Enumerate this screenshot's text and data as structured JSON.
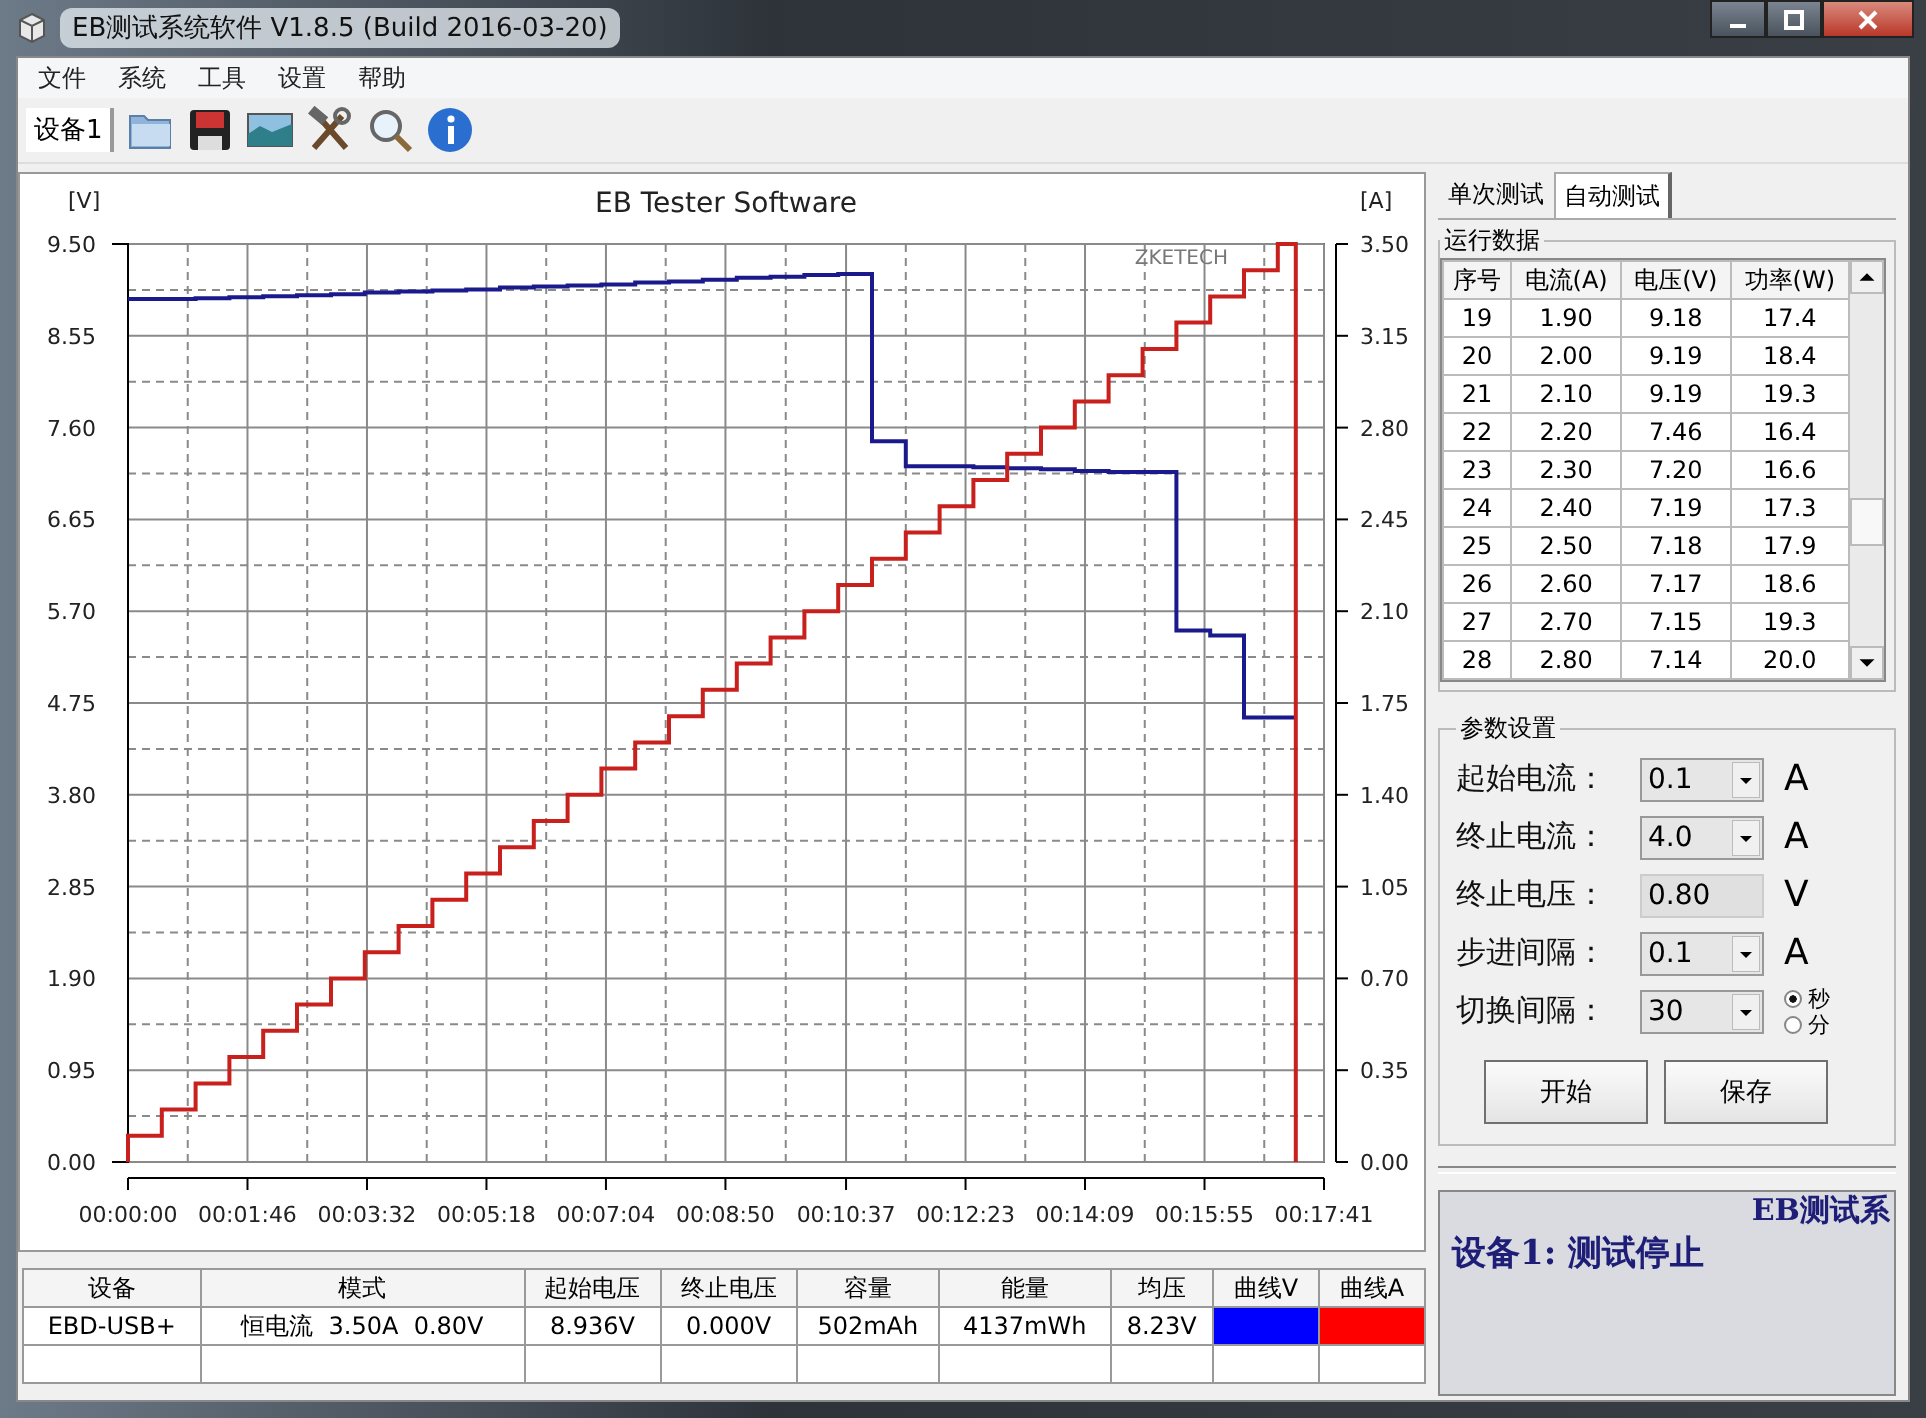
{
  "window": {
    "title": "EB测试系统软件 V1.8.5 (Build 2016-03-20)"
  },
  "menu": [
    "文件",
    "系统",
    "工具",
    "设置",
    "帮助"
  ],
  "toolbar": {
    "device_tab": "设备1",
    "tools": [
      {
        "kind": "folder"
      },
      {
        "kind": "save"
      },
      {
        "kind": "image"
      },
      {
        "kind": "tools"
      },
      {
        "kind": "search"
      },
      {
        "kind": "info"
      }
    ]
  },
  "chart": {
    "watermark_label": "ZKETECH",
    "chart_data": {
      "type": "line",
      "title": "EB Tester Software",
      "ylabel": "[V]",
      "y2label": "[A]",
      "x": [
        0,
        0,
        30,
        30,
        60,
        60,
        90,
        90,
        120,
        120,
        150,
        150,
        180,
        180,
        210,
        210,
        240,
        240,
        270,
        270,
        300,
        300,
        330,
        330,
        360,
        360,
        390,
        390,
        420,
        420,
        450,
        450,
        480,
        480,
        510,
        510,
        540,
        540,
        570,
        570,
        600,
        600,
        630,
        630,
        660,
        660,
        690,
        690,
        720,
        720,
        750,
        750,
        780,
        780,
        810,
        810,
        840,
        840,
        870,
        870,
        900,
        900,
        930,
        930,
        960,
        960,
        990,
        990,
        1020,
        1020,
        1036,
        1036
      ],
      "xlim": [
        0,
        1061
      ],
      "grid": true,
      "ylim": [
        0,
        9.5
      ],
      "y2lim": [
        0,
        3.5
      ],
      "xticks": [
        {
          "value": 0,
          "label": "00:00:00"
        },
        {
          "value": 106,
          "label": "00:01:46"
        },
        {
          "value": 212,
          "label": "00:03:32"
        },
        {
          "value": 318,
          "label": "00:05:18"
        },
        {
          "value": 424,
          "label": "00:07:04"
        },
        {
          "value": 530,
          "label": "00:08:50"
        },
        {
          "value": 637,
          "label": "00:10:37"
        },
        {
          "value": 743,
          "label": "00:12:23"
        },
        {
          "value": 849,
          "label": "00:14:09"
        },
        {
          "value": 955,
          "label": "00:15:55"
        },
        {
          "value": 1061,
          "label": "00:17:41"
        }
      ],
      "yticks": [
        {
          "value": 0,
          "label": "0.00"
        },
        {
          "value": 0.95,
          "label": "0.95"
        },
        {
          "value": 1.9,
          "label": "1.90"
        },
        {
          "value": 2.85,
          "label": "2.85"
        },
        {
          "value": 3.8,
          "label": "3.80"
        },
        {
          "value": 4.75,
          "label": "4.75"
        },
        {
          "value": 5.7,
          "label": "5.70"
        },
        {
          "value": 6.65,
          "label": "6.65"
        },
        {
          "value": 7.6,
          "label": "7.60"
        },
        {
          "value": 8.55,
          "label": "8.55"
        },
        {
          "value": 9.5,
          "label": "9.50"
        }
      ],
      "y2ticks": [
        {
          "value": 0,
          "label": "0.00"
        },
        {
          "value": 0.35,
          "label": "0.35"
        },
        {
          "value": 0.7,
          "label": "0.70"
        },
        {
          "value": 1.05,
          "label": "1.05"
        },
        {
          "value": 1.4,
          "label": "1.40"
        },
        {
          "value": 1.75,
          "label": "1.75"
        },
        {
          "value": 2.1,
          "label": "2.10"
        },
        {
          "value": 2.45,
          "label": "2.45"
        },
        {
          "value": 2.8,
          "label": "2.80"
        },
        {
          "value": 3.15,
          "label": "3.15"
        },
        {
          "value": 3.5,
          "label": "3.50"
        }
      ],
      "series": [
        {
          "color": "#1a1a8c",
          "values": [
            null,
            8.93,
            8.93,
            8.93,
            8.93,
            8.94,
            8.94,
            8.95,
            8.95,
            8.96,
            8.96,
            8.97,
            8.97,
            8.98,
            8.98,
            9.0,
            9.0,
            9.01,
            9.01,
            9.02,
            9.02,
            9.03,
            9.03,
            9.05,
            9.05,
            9.06,
            9.06,
            9.07,
            9.07,
            9.08,
            9.08,
            9.1,
            9.1,
            9.11,
            9.11,
            9.13,
            9.13,
            9.15,
            9.15,
            9.16,
            9.16,
            9.18,
            9.18,
            9.19,
            9.19,
            7.46,
            7.46,
            7.2,
            7.2,
            7.2,
            7.2,
            7.19,
            7.19,
            7.18,
            7.18,
            7.17,
            7.17,
            7.15,
            7.15,
            7.14,
            7.14,
            7.14,
            7.14,
            5.5,
            5.5,
            5.45,
            5.45,
            4.6,
            4.6,
            4.6,
            4.6,
            4.6
          ]
        },
        {
          "color": "#c8201c",
          "axis": "y2",
          "values": [
            0,
            0.1,
            0.1,
            0.2,
            0.2,
            0.3,
            0.3,
            0.4,
            0.4,
            0.5,
            0.5,
            0.6,
            0.6,
            0.7,
            0.7,
            0.8,
            0.8,
            0.9,
            0.9,
            1.0,
            1.0,
            1.1,
            1.1,
            1.2,
            1.2,
            1.3,
            1.3,
            1.4,
            1.4,
            1.5,
            1.5,
            1.6,
            1.6,
            1.7,
            1.7,
            1.8,
            1.8,
            1.9,
            1.9,
            2.0,
            2.0,
            2.1,
            2.1,
            2.2,
            2.2,
            2.3,
            2.3,
            2.4,
            2.4,
            2.5,
            2.5,
            2.6,
            2.6,
            2.7,
            2.7,
            2.8,
            2.8,
            2.9,
            2.9,
            3.0,
            3.0,
            3.1,
            3.1,
            3.2,
            3.2,
            3.3,
            3.3,
            3.4,
            3.4,
            3.5,
            3.5,
            0
          ]
        }
      ]
    }
  },
  "summary_table": {
    "columns": [
      "设备",
      "模式",
      "起始电压",
      "终止电压",
      "容量",
      "能量",
      "均压",
      "曲线V",
      "曲线A"
    ],
    "rows": [
      {
        "cells": [
          "EBD-USB+",
          "恒电流  3.50A  0.80V",
          "8.936V",
          "0.000V",
          "502mAh",
          "4137mWh",
          "8.23V"
        ],
        "curves": [
          {
            "color": "#0000ff"
          },
          {
            "color": "#ff0000"
          }
        ]
      }
    ]
  },
  "side_tabs": [
    {
      "label": "单次测试",
      "selected": false
    },
    {
      "label": "自动测试",
      "selected": true
    }
  ],
  "run_data": {
    "title": "运行数据",
    "columns": [
      "序号",
      "电流(A)",
      "电压(V)",
      "功率(W)"
    ],
    "rows": [
      [
        "19",
        "1.90",
        "9.18",
        "17.4"
      ],
      [
        "20",
        "2.00",
        "9.19",
        "18.4"
      ],
      [
        "21",
        "2.10",
        "9.19",
        "19.3"
      ],
      [
        "22",
        "2.20",
        "7.46",
        "16.4"
      ],
      [
        "23",
        "2.30",
        "7.20",
        "16.6"
      ],
      [
        "24",
        "2.40",
        "7.19",
        "17.3"
      ],
      [
        "25",
        "2.50",
        "7.18",
        "17.9"
      ],
      [
        "26",
        "2.60",
        "7.17",
        "18.6"
      ],
      [
        "27",
        "2.70",
        "7.15",
        "19.3"
      ],
      [
        "28",
        "2.80",
        "7.14",
        "20.0"
      ]
    ]
  },
  "params": {
    "title": "参数设置",
    "items": [
      {
        "label": "起始电流：",
        "kind": "combo",
        "value": "0.1",
        "unit": "A"
      },
      {
        "label": "终止电流：",
        "kind": "combo",
        "value": "4.0",
        "unit": "A"
      },
      {
        "label": "终止电压：",
        "kind": "field",
        "value": "0.80",
        "unit": "V"
      },
      {
        "label": "步进间隔：",
        "kind": "combo",
        "value": "0.1",
        "unit": "A"
      },
      {
        "label": "切换间隔：",
        "kind": "combo",
        "value": "30",
        "options": [
          {
            "label": "秒",
            "selected": true
          },
          {
            "label": "分",
            "selected": false
          }
        ]
      }
    ],
    "buttons": [
      "开始",
      "保存"
    ]
  },
  "status": {
    "banner": "EB测试系",
    "message": "设备1: 测试停止"
  }
}
